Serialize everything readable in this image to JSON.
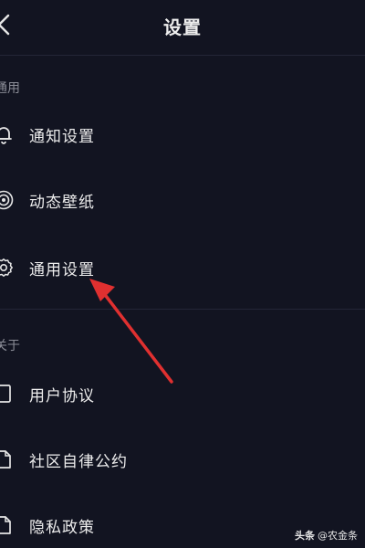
{
  "header": {
    "title": "设置"
  },
  "sections": [
    {
      "label": "通用",
      "items": [
        {
          "label": "通知设置",
          "icon": "bell-icon"
        },
        {
          "label": "动态壁纸",
          "icon": "dynamic-wallpaper-icon"
        },
        {
          "label": "通用设置",
          "icon": "gear-icon"
        }
      ]
    },
    {
      "label": "关于",
      "items": [
        {
          "label": "用户协议",
          "icon": "document-icon"
        },
        {
          "label": "社区自律公约",
          "icon": "document-icon"
        },
        {
          "label": "隐私政策",
          "icon": "document-icon"
        }
      ]
    }
  ],
  "annotation": {
    "arrow_color": "#e03030"
  },
  "watermark": {
    "brand": "头条",
    "handle": "@农金条"
  },
  "colors": {
    "background": "#121421",
    "text": "#ededed",
    "section_label": "#8b8d97",
    "divider": "#242637"
  }
}
